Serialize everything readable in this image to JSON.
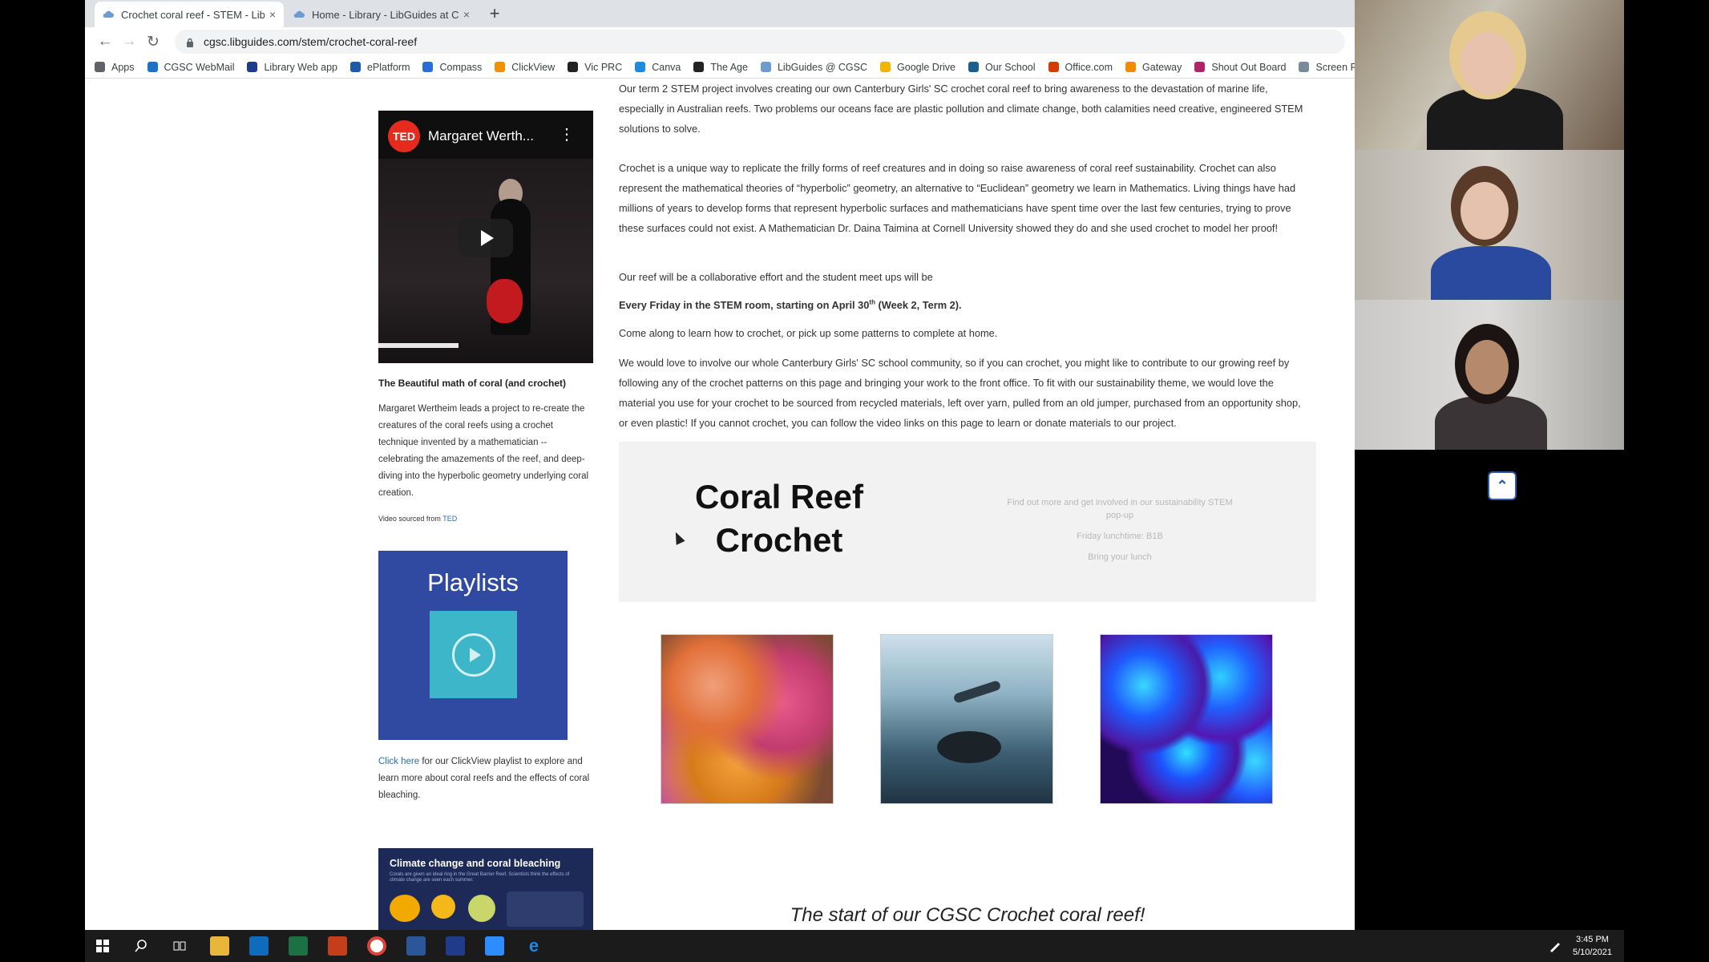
{
  "browser": {
    "tabs": [
      {
        "title": "Crochet coral reef - STEM - LibG",
        "close": "×"
      },
      {
        "title": "Home - Library - LibGuides at Ca",
        "close": "×"
      }
    ],
    "new_tab": "+",
    "nav": {
      "back": "←",
      "forward": "→",
      "reload": "↻"
    },
    "url": "cgsc.libguides.com/stem/crochet-coral-reef",
    "bookmarks": [
      {
        "label": "Apps",
        "color": "#5f6368"
      },
      {
        "label": "CGSC WebMail",
        "color": "#1a73c8"
      },
      {
        "label": "Library Web app",
        "color": "#1f3b8a"
      },
      {
        "label": "ePlatform",
        "color": "#1e5aa8"
      },
      {
        "label": "Compass",
        "color": "#2b6dd8"
      },
      {
        "label": "ClickView",
        "color": "#f29100"
      },
      {
        "label": "Vic PRC",
        "color": "#222222"
      },
      {
        "label": "Canva",
        "color": "#1f8be0"
      },
      {
        "label": "The Age",
        "color": "#222222"
      },
      {
        "label": "LibGuides @ CGSC",
        "color": "#6c9bd2"
      },
      {
        "label": "Google Drive",
        "color": "#f4b400"
      },
      {
        "label": "Our School",
        "color": "#1a5f8e"
      },
      {
        "label": "Office.com",
        "color": "#d83b01"
      },
      {
        "label": "Gateway",
        "color": "#f08c00"
      },
      {
        "label": "Shout Out Board",
        "color": "#b0226a"
      },
      {
        "label": "Screen Recc",
        "color": "#7a8a9a"
      }
    ]
  },
  "video": {
    "badge": "TED",
    "title": "Margaret Werth...",
    "menu": "⋮",
    "heading": "The Beautiful math of coral (and crochet)",
    "description": "Margaret Wertheim leads a project to re-create the creatures of the coral reefs using a crochet technique invented by a mathematician -- celebrating the amazements of the reef, and deep-diving into the hyperbolic geometry underlying coral creation.",
    "credit_prefix": "Video sourced from ",
    "credit_link": "TED"
  },
  "playlists": {
    "title": "Playlists",
    "link": "Click here",
    "text": " for our ClickView playlist to explore and learn more about coral reefs and the effects of coral bleaching."
  },
  "climate": {
    "title": "Climate change and coral bleaching",
    "subtitle": "Corals are given an ideal ring in the Great Barrier Reef. Scientists think the effects of climate change are seen each summer."
  },
  "main": {
    "p1": "Our term 2 STEM project involves creating our own Canterbury Girls' SC crochet coral reef to bring awareness to the devastation of marine life, especially in Australian reefs. Two problems our oceans face are plastic pollution and climate change, both calamities need creative, engineered STEM solutions to solve.",
    "p2": "Crochet is a unique way to replicate the frilly forms of reef creatures and in doing so raise awareness of coral reef sustainability. Crochet can also represent the mathematical theories of “hyperbolic” geometry, an alternative to “Euclidean” geometry we learn in Mathematics. Living things have had millions of years to develop forms that represent hyperbolic surfaces and mathematicians have spent time over the last few centuries, trying to prove these surfaces could not exist. A Mathematician Dr. Daina Taimina at Cornell University showed they do and she used crochet to model her proof!",
    "p3": "Our reef will be a collaborative effort and the student meet ups will be",
    "date_a": "Every Friday in the STEM room, starting on April 30",
    "date_sup": "th",
    "date_b": " (Week 2, Term 2).",
    "p4": "Come along to learn how to crochet, or pick up some patterns to complete at home.",
    "p5": "We would love to involve our whole Canterbury Girls' SC school community, so if you can crochet, you might like to contribute to our growing reef by following any of the crochet patterns on this page and bringing your work to the front office.   To fit with our sustainability theme, we would love the material you use for your crochet to be sourced from recycled materials, left over yarn, pulled from an old jumper, purchased from an opportunity shop, or even plastic! If you cannot crochet, you can follow the video links on this page to learn or donate materials to our project.",
    "banner": {
      "title": "Coral Reef Crochet",
      "info1": "Find out more and get involved in our sustainability STEM pop-up",
      "info2": "Friday lunchtime: B1B",
      "info3": "Bring your lunch"
    },
    "caption": "The start of our CGSC Crochet coral reef!"
  },
  "back_to_top": "⌃",
  "taskbar": {
    "time": "3:45 PM",
    "date": "5/10/2021"
  }
}
